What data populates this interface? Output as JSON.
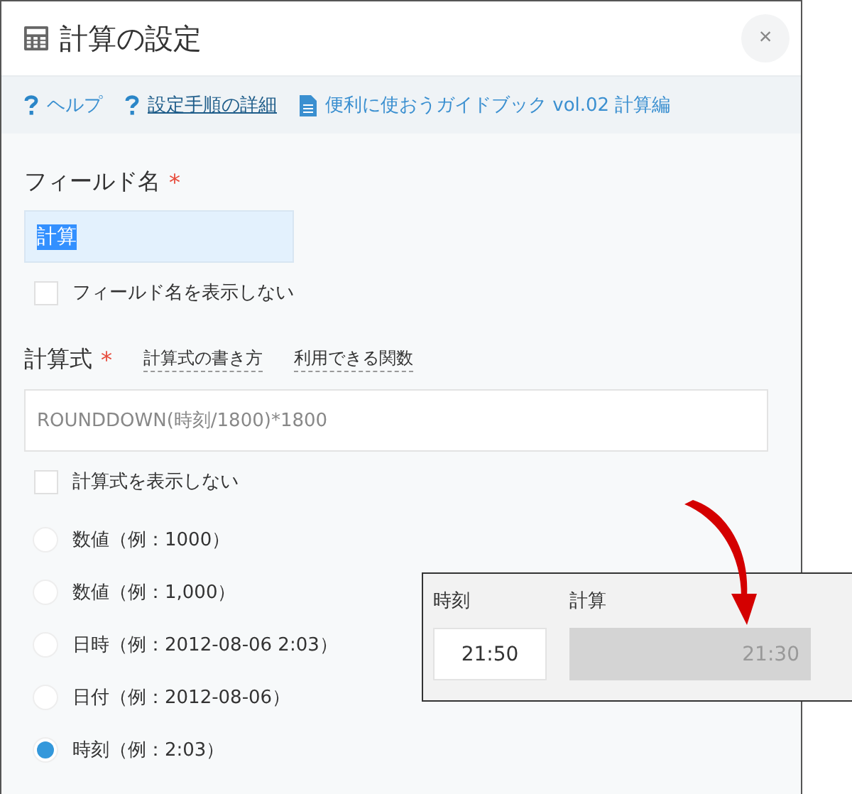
{
  "dialog": {
    "title": "計算の設定",
    "close": "×"
  },
  "links": [
    {
      "kind": "question",
      "label": "ヘルプ",
      "underlined": false
    },
    {
      "kind": "question",
      "label": "設定手順の詳細",
      "underlined": true
    },
    {
      "kind": "document",
      "label": "便利に使おうガイドブック vol.02 計算編",
      "underlined": false
    }
  ],
  "field_name": {
    "label": "フィールド名",
    "required": "*",
    "value": "計算",
    "value_selected": true,
    "hide": {
      "label": "フィールド名を表示しない",
      "checked": false
    }
  },
  "formula": {
    "label": "計算式",
    "required": "*",
    "help_links": [
      "計算式の書き方",
      "利用できる関数"
    ],
    "value": "ROUNDDOWN(時刻/1800)*1800",
    "hide": {
      "label": "計算式を表示しない",
      "checked": false
    }
  },
  "formats": [
    {
      "label": "数値（例：1000）",
      "selected": false
    },
    {
      "label": "数値（例：1,000）",
      "selected": false
    },
    {
      "label": "日時（例：2012-08-06 2:03）",
      "selected": false
    },
    {
      "label": "日付（例：2012-08-06）",
      "selected": false
    },
    {
      "label": "時刻（例：2:03）",
      "selected": true
    }
  ],
  "preview": {
    "columns": [
      {
        "header": "時刻",
        "value": "21:50",
        "kind": "input"
      },
      {
        "header": "計算",
        "value": "21:30",
        "kind": "computed"
      }
    ]
  }
}
